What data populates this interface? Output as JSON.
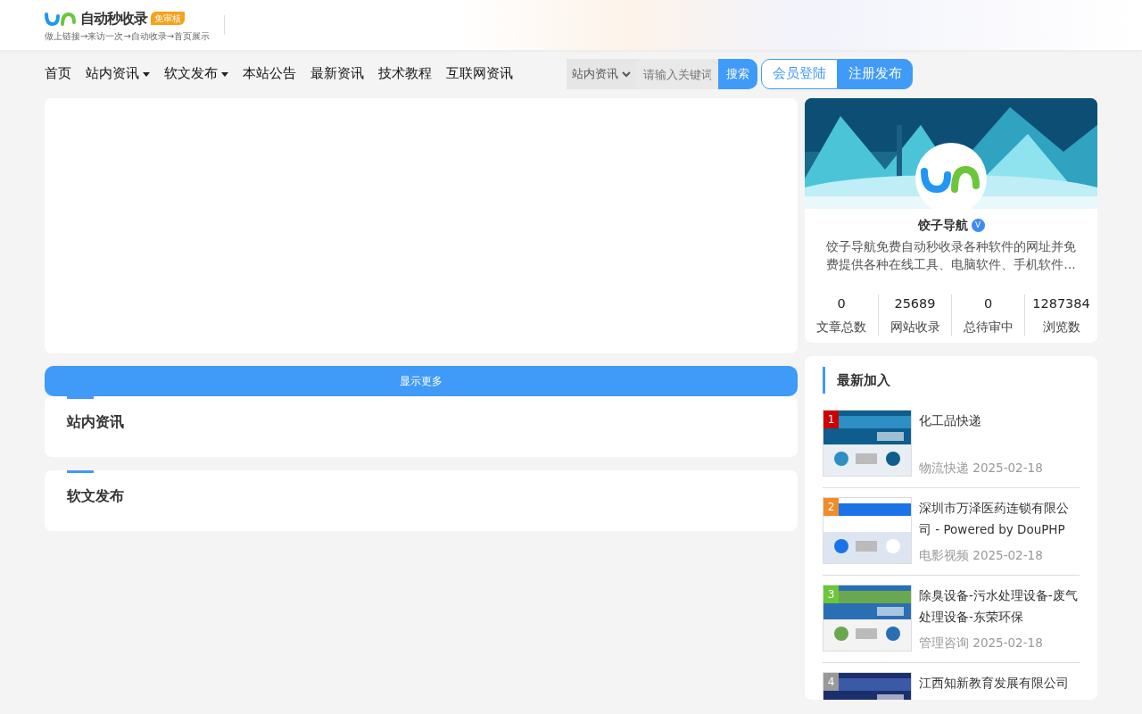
{
  "header": {
    "logo_text": "自动秒收录",
    "logo_badge": "免审核",
    "logo_slogan": "做上链接→来访一次→自动收录→首页展示"
  },
  "nav": [
    {
      "label": "首页",
      "dropdown": false
    },
    {
      "label": "站内资讯",
      "dropdown": true
    },
    {
      "label": "软文发布",
      "dropdown": true
    },
    {
      "label": "本站公告",
      "dropdown": false
    },
    {
      "label": "最新资讯",
      "dropdown": false
    },
    {
      "label": "技术教程",
      "dropdown": false
    },
    {
      "label": "互联网资讯",
      "dropdown": false
    }
  ],
  "search": {
    "category": "站内资讯",
    "placeholder": "请输入关键词",
    "button": "搜索"
  },
  "auth": {
    "login": "会员登陆",
    "register": "注册发布"
  },
  "show_more": "显示更多",
  "sections": [
    {
      "title": "站内资讯"
    },
    {
      "title": "软文发布"
    }
  ],
  "profile": {
    "name": "饺子导航",
    "verified_mark": "V",
    "description": "饺子导航免费自动秒收录各种软件的网址并免费提供各种在线工具、电脑软件、手机软件…",
    "stats": [
      {
        "value": "0",
        "label": "文章总数"
      },
      {
        "value": "25689",
        "label": "网站收录"
      },
      {
        "value": "0",
        "label": "总待审中"
      },
      {
        "value": "1287384",
        "label": "浏览数"
      }
    ]
  },
  "latest": {
    "title": "最新加入",
    "items": [
      {
        "rank": "1",
        "color": "#cc0000",
        "title": "化工品快递",
        "category": "物流快递",
        "date": "2025-02-18"
      },
      {
        "rank": "2",
        "color": "#f08c2a",
        "title": "深圳市万泽医药连锁有限公司 - Powered by DouPHP",
        "category": "电影视频",
        "date": "2025-02-18"
      },
      {
        "rank": "3",
        "color": "#6cc63a",
        "title": "除臭设备-污水处理设备-废气处理设备-东荣环保",
        "category": "管理咨询",
        "date": "2025-02-18"
      },
      {
        "rank": "4",
        "color": "#999999",
        "title": "江西知新教育发展有限公司"
      }
    ]
  }
}
